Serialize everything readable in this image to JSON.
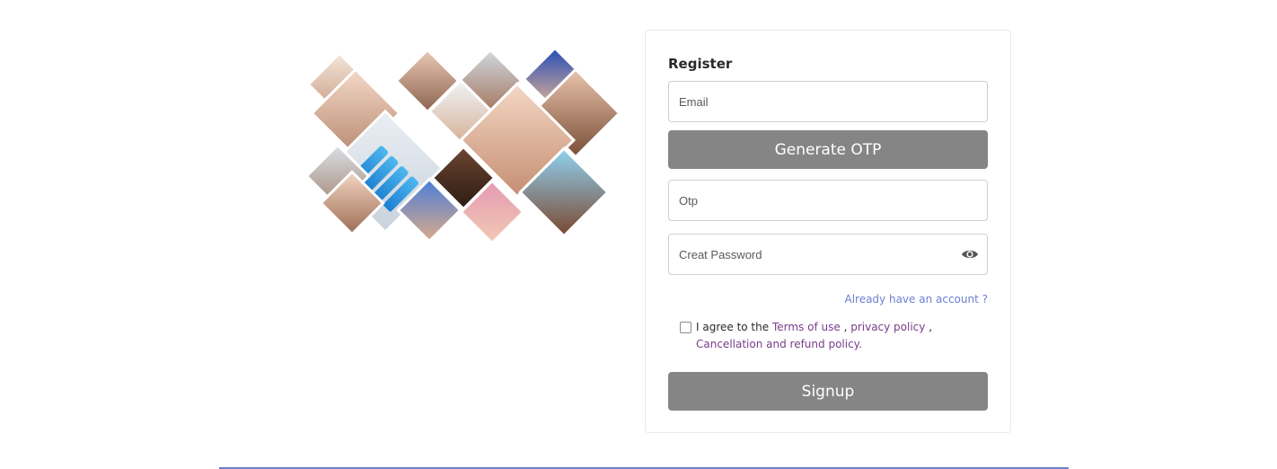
{
  "form": {
    "title": "Register",
    "email_placeholder": "Email",
    "generate_otp_label": "Generate OTP",
    "otp_placeholder": "Otp",
    "password_placeholder": "Creat Password",
    "login_link": "Already have an account ?",
    "agree_prefix": "I agree to the",
    "terms_link": "Terms of use",
    "separator_1": " , ",
    "privacy_link": "privacy policy",
    "separator_2": " ,",
    "refund_link": "Cancellation and refund policy.",
    "signup_label": "Signup"
  },
  "icons": {
    "password_toggle": "eye-icon",
    "collage": "treatment-collage-image"
  },
  "colors": {
    "button_bg": "#858585",
    "link_blue": "#6b7fd0",
    "link_purple": "#7a3c8c",
    "border": "#cfcfcf"
  }
}
